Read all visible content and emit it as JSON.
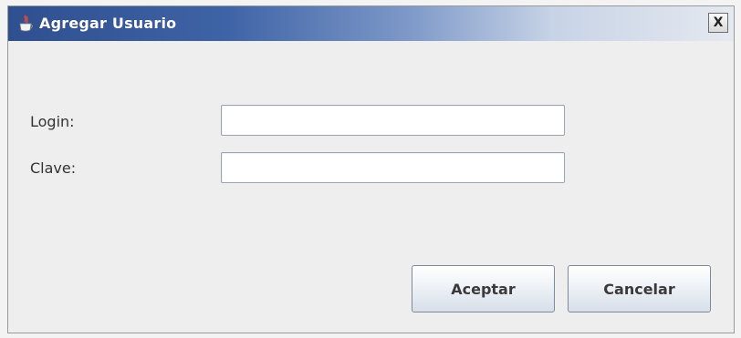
{
  "window": {
    "title": "Agregar Usuario",
    "icon": "java-cup-icon",
    "close_label": "X"
  },
  "form": {
    "login_label": "Login:",
    "login_value": "",
    "clave_label": "Clave:",
    "clave_value": ""
  },
  "buttons": {
    "accept_label": "Aceptar",
    "cancel_label": "Cancelar"
  },
  "colors": {
    "title_gradient_start": "#2f4f8f",
    "title_gradient_end": "#e5e9f0",
    "background": "#eeeeee"
  }
}
